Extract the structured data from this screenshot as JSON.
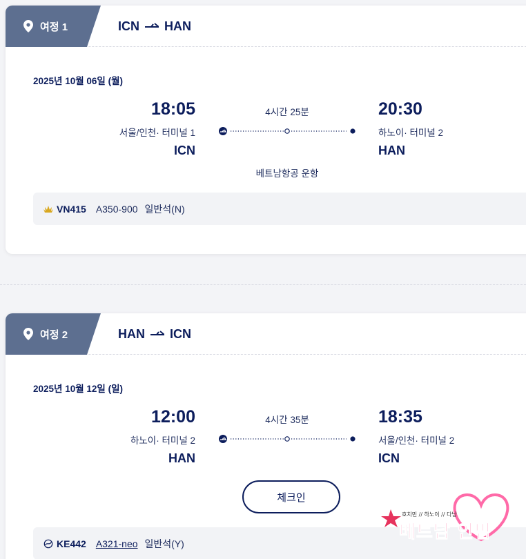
{
  "colors": {
    "navy": "#0c1d5c",
    "tag_bg": "#5d6f90",
    "bar_bg": "#f2f3f6",
    "vn_gold": "#d9a820"
  },
  "itineraries": [
    {
      "tag": "여정 1",
      "route_from": "ICN",
      "route_to": "HAN",
      "date": "2025년 10월 06일 (월)",
      "depart": {
        "time": "18:05",
        "place": "서울/인천· 터미널  1",
        "code": "ICN"
      },
      "arrive": {
        "time": "20:30",
        "place": "하노이· 터미널  2",
        "code": "HAN"
      },
      "duration": "4시간 25분",
      "operator": "베트남항공 운항",
      "flight": {
        "airline_icon": "vietnam-airlines-lotus-icon",
        "number": "VN415",
        "aircraft": "A350-900",
        "cabin": "일반석(N)"
      }
    },
    {
      "tag": "여정 2",
      "route_from": "HAN",
      "route_to": "ICN",
      "date": "2025년 10월 12일 (일)",
      "depart": {
        "time": "12:00",
        "place": "하노이· 터미널  2",
        "code": "HAN"
      },
      "arrive": {
        "time": "18:35",
        "place": "서울/인천· 터미널  2",
        "code": "ICN"
      },
      "duration": "4시간 35분",
      "checkin_label": "체크인",
      "flight": {
        "airline_icon": "korean-air-icon",
        "number": "KE442",
        "aircraft": "A321-neo",
        "cabin": "일반석(Y)"
      }
    }
  ],
  "watermark": {
    "text": "베트남 안밤",
    "small_text": "호치민 // 하노이 // 다낭"
  }
}
